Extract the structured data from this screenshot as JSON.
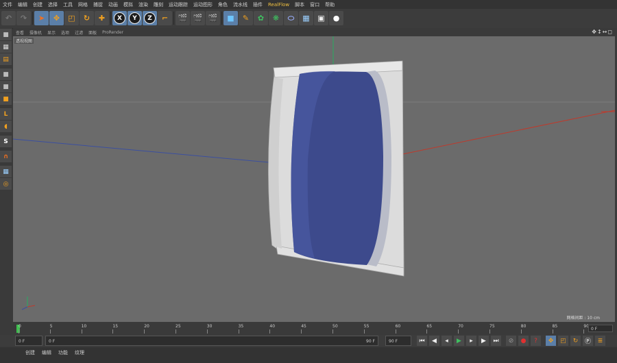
{
  "menu": [
    "文件",
    "编辑",
    "创建",
    "选择",
    "工具",
    "网格",
    "捕捉",
    "动画",
    "模拟",
    "渲染",
    "雕刻",
    "运动跟踪",
    "运动图形",
    "角色",
    "流水线",
    "插件",
    "RealFlow",
    "脚本",
    "窗口",
    "帮助"
  ],
  "toolbar": {
    "x_label": "X",
    "y_label": "Y",
    "z_label": "Z"
  },
  "viewport": {
    "menu": [
      "查看",
      "摄像机",
      "显示",
      "选项",
      "过滤",
      "面板",
      "ProRender"
    ],
    "label": "透视视图",
    "grid_info": "网格间距 : 10 cm"
  },
  "timeline": {
    "ticks": [
      "0",
      "5",
      "10",
      "15",
      "20",
      "25",
      "30",
      "35",
      "40",
      "45",
      "50",
      "55",
      "60",
      "65",
      "70",
      "75",
      "80",
      "85",
      "90"
    ],
    "end_label": "0 F"
  },
  "controls": {
    "current_frame": "0 F",
    "start_frame": "0 F",
    "end_frame": "90 F",
    "max_frame": "90 F"
  },
  "bottom_tabs": [
    "创建",
    "编辑",
    "功能",
    "纹理"
  ],
  "colors": {
    "viewport_bg": "#6b6b6b",
    "x_axis": "#c0392b",
    "y_axis": "#27ae60",
    "z_axis": "#3b4fa0",
    "label_blue": "#3d4a8c"
  }
}
